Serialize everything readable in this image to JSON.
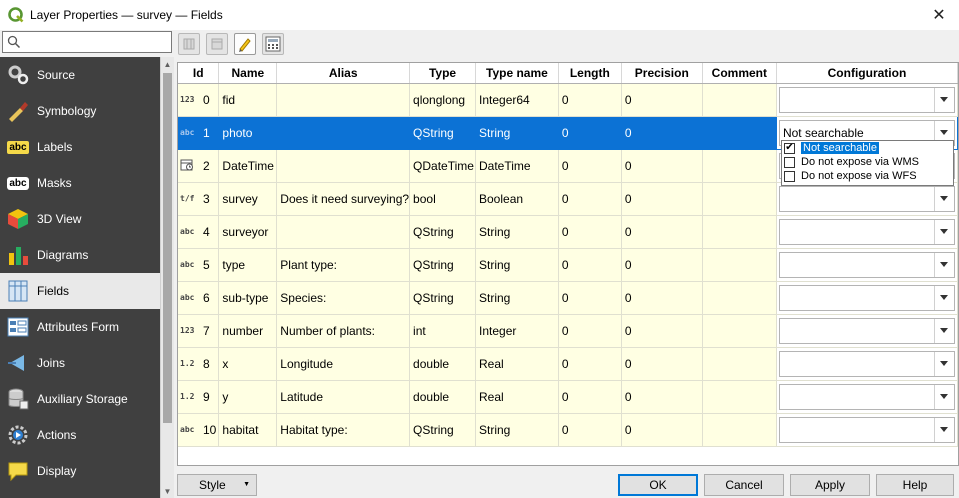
{
  "window": {
    "title": "Layer Properties — survey — Fields",
    "close_glyph": "✕"
  },
  "search": {
    "placeholder": "",
    "value": ""
  },
  "sidebar": {
    "items": [
      {
        "label": "Source",
        "icon": "source-icon"
      },
      {
        "label": "Symbology",
        "icon": "symbology-icon"
      },
      {
        "label": "Labels",
        "icon": "labels-icon",
        "icon_text": "abc"
      },
      {
        "label": "Masks",
        "icon": "masks-icon",
        "icon_text": "abc"
      },
      {
        "label": "3D View",
        "icon": "3d-view-icon"
      },
      {
        "label": "Diagrams",
        "icon": "diagrams-icon"
      },
      {
        "label": "Fields",
        "icon": "fields-icon",
        "selected": true
      },
      {
        "label": "Attributes Form",
        "icon": "attributes-form-icon"
      },
      {
        "label": "Joins",
        "icon": "joins-icon"
      },
      {
        "label": "Auxiliary Storage",
        "icon": "auxiliary-storage-icon"
      },
      {
        "label": "Actions",
        "icon": "actions-icon"
      },
      {
        "label": "Display",
        "icon": "display-icon"
      }
    ]
  },
  "toolbar": {
    "buttons": [
      "new-field-icon",
      "delete-field-icon",
      "toggle-editing-icon",
      "field-calculator-icon"
    ]
  },
  "table": {
    "headers": [
      "Id",
      "Name",
      "Alias",
      "Type",
      "Type name",
      "Length",
      "Precision",
      "Comment",
      "Configuration"
    ],
    "rows": [
      {
        "code": "123",
        "id": "0",
        "name": "fid",
        "alias": "",
        "type": "qlonglong",
        "type_name": "Integer64",
        "length": "0",
        "precision": "0",
        "comment": "",
        "config": ""
      },
      {
        "code": "abc",
        "id": "1",
        "name": "photo",
        "alias": "",
        "type": "QString",
        "type_name": "String",
        "length": "0",
        "precision": "0",
        "comment": "",
        "config": "Not searchable",
        "selected": true
      },
      {
        "code": "cal",
        "id": "2",
        "name": "DateTime",
        "alias": "",
        "type": "QDateTime",
        "type_name": "DateTime",
        "length": "0",
        "precision": "0",
        "comment": "",
        "config": ""
      },
      {
        "code": "t/f",
        "id": "3",
        "name": "survey",
        "alias": "Does it need surveying?",
        "type": "bool",
        "type_name": "Boolean",
        "length": "0",
        "precision": "0",
        "comment": "",
        "config": ""
      },
      {
        "code": "abc",
        "id": "4",
        "name": "surveyor",
        "alias": "",
        "type": "QString",
        "type_name": "String",
        "length": "0",
        "precision": "0",
        "comment": "",
        "config": ""
      },
      {
        "code": "abc",
        "id": "5",
        "name": "type",
        "alias": "Plant type:",
        "type": "QString",
        "type_name": "String",
        "length": "0",
        "precision": "0",
        "comment": "",
        "config": ""
      },
      {
        "code": "abc",
        "id": "6",
        "name": "sub-type",
        "alias": "Species:",
        "type": "QString",
        "type_name": "String",
        "length": "0",
        "precision": "0",
        "comment": "",
        "config": ""
      },
      {
        "code": "123",
        "id": "7",
        "name": "number",
        "alias": "Number of plants:",
        "type": "int",
        "type_name": "Integer",
        "length": "0",
        "precision": "0",
        "comment": "",
        "config": ""
      },
      {
        "code": "1.2",
        "id": "8",
        "name": "x",
        "alias": "Longitude",
        "type": "double",
        "type_name": "Real",
        "length": "0",
        "precision": "0",
        "comment": "",
        "config": ""
      },
      {
        "code": "1.2",
        "id": "9",
        "name": "y",
        "alias": "Latitude",
        "type": "double",
        "type_name": "Real",
        "length": "0",
        "precision": "0",
        "comment": "",
        "config": ""
      },
      {
        "code": "abc",
        "id": "10",
        "name": "habitat",
        "alias": "Habitat type:",
        "type": "QString",
        "type_name": "String",
        "length": "0",
        "precision": "0",
        "comment": "",
        "config": ""
      }
    ]
  },
  "config_dropdown": {
    "options": [
      {
        "label": "Not searchable",
        "checked": true,
        "highlighted": true
      },
      {
        "label": "Do not expose via WMS",
        "checked": false
      },
      {
        "label": "Do not expose via WFS",
        "checked": false
      }
    ]
  },
  "buttons": {
    "style": "Style",
    "ok": "OK",
    "cancel": "Cancel",
    "apply": "Apply",
    "help": "Help"
  },
  "colors": {
    "selection": "#0c72d5",
    "row_bg": "#ffffe3",
    "sidebar_bg": "#404040"
  }
}
